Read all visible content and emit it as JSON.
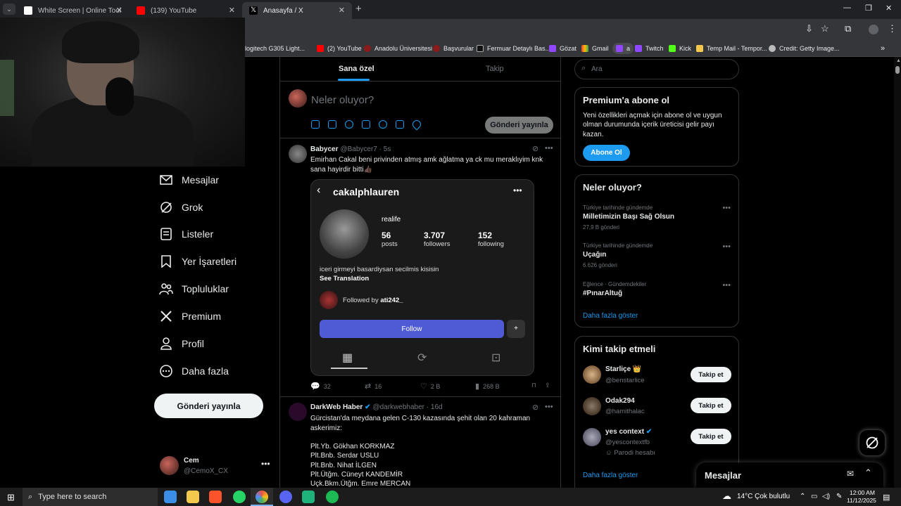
{
  "browser": {
    "tabs": [
      {
        "title": "White Screen | Online Tool",
        "active": false
      },
      {
        "title": "(139) YouTube",
        "active": false
      },
      {
        "title": "Anasayfa / X",
        "active": true
      }
    ],
    "bookmarks": [
      "logitech G305 Light...",
      "(2) YouTube",
      "Anadolu Üniversitesi",
      "Başvurular",
      "Fermuar Detaylı Bas...",
      "Gözat",
      "Gmail",
      "a",
      "Twitch",
      "Kick",
      "Temp Mail - Tempor...",
      "Credit: Getty Image..."
    ]
  },
  "nav": {
    "items": [
      "Mesajlar",
      "Grok",
      "Listeler",
      "Yer İşaretleri",
      "Topluluklar",
      "Premium",
      "Profil",
      "Daha fazla"
    ],
    "post_button": "Gönderi yayınla",
    "account": {
      "name": "Cem",
      "handle": "@CemoX_CX"
    }
  },
  "feed": {
    "tabs": [
      "Sana özel",
      "Takip"
    ],
    "compose_placeholder": "Neler oluyor?",
    "post_button": "Gönderi yayınla",
    "tweets": [
      {
        "name": "Babycer",
        "handle": "@Babycer7 · 5s",
        "text": "Emirhan Cakal beni privinden atmış amk ağlatma ya ck mu meraklıyim knk sana hayirdir bitti👍🏿",
        "card": {
          "username": "cakalphlauren",
          "bio_name": "realife",
          "posts_value": "56",
          "posts_label": "posts",
          "followers_value": "3.707",
          "followers_label": "followers",
          "following_value": "152",
          "following_label": "following",
          "bio": "iceri girmeyi basardiysan secilmis kisisin",
          "see_translation": "See Translation",
          "followed_by_prefix": "Followed by",
          "followed_by_user": "ati242_",
          "follow_button": "Follow"
        },
        "actions": {
          "replies": "32",
          "reposts": "16",
          "likes": "2 B",
          "views": "268 B"
        }
      },
      {
        "name": "DarkWeb Haber",
        "handle": "@darkwebhaber · 16d",
        "text": "Gürcistan'da meydana gelen C-130 kazasında şehit olan 20 kahraman askerimiz:",
        "lines": [
          "Plt.Yb. Gökhan KORKMAZ",
          "Plt.Bnb. Serdar USLU",
          "Plt.Bnb. Nihat İLGEN",
          "Plt.Ütğm. Cüneyt KANDEMİR",
          "Uçk.Bkm.Ütğm. Emre MERCAN"
        ]
      }
    ]
  },
  "sidebar": {
    "search_placeholder": "Ara",
    "premium": {
      "title": "Premium'a abone ol",
      "text": "Yeni özellikleri açmak için abone ol ve uygun olman durumunda içerik üreticisi gelir payı kazan.",
      "button": "Abone Ol"
    },
    "trends": {
      "title": "Neler oluyor?",
      "items": [
        {
          "meta": "Türkiye tarihinde gündemde",
          "name": "Milletimizin Başı Sağ Olsun",
          "count": "27,9 B gönderi"
        },
        {
          "meta": "Türkiye tarihinde gündemde",
          "name": "Uçağın",
          "count": "6.626 gönderi"
        },
        {
          "meta": "Eğlence · Gündemdekiler",
          "name": "#PınarAltuğ",
          "count": ""
        }
      ],
      "more": "Daha fazla göster"
    },
    "who_to_follow": {
      "title": "Kimi takip etmeli",
      "users": [
        {
          "name": "Starliçe 👑",
          "handle": "@benstarlice",
          "button": "Takip et"
        },
        {
          "name": "Odak294",
          "handle": "@hamithalac",
          "button": "Takip et"
        },
        {
          "name": "yes context",
          "handle": "@yescontextfb",
          "sub": "Parodi hesabı",
          "button": "Takip et"
        }
      ],
      "more": "Daha fazla göster"
    },
    "messages_title": "Mesajlar"
  },
  "taskbar": {
    "search": "Type here to search",
    "weather": "14°C  Çok bulutlu",
    "time": "12:00 AM",
    "date": "11/12/2025"
  },
  "colors": {
    "accent": "#1d9bf0",
    "ig_follow": "#4f5bd5"
  }
}
